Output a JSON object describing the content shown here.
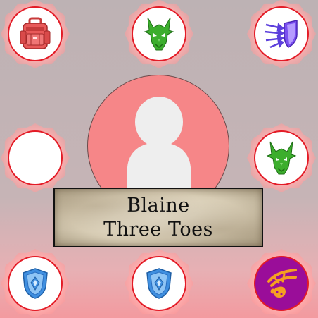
{
  "character": {
    "name_line1": "Blaine",
    "name_line2": "Three Toes"
  },
  "slots": [
    {
      "id": "top-left",
      "icon": "backpack-icon",
      "filled": true,
      "color": "#d94a4a"
    },
    {
      "id": "top-center",
      "icon": "dragon-head-icon",
      "filled": true,
      "color": "#3cae2d"
    },
    {
      "id": "top-right",
      "icon": "magic-shield-icon",
      "filled": true,
      "color": "#5c3fdc"
    },
    {
      "id": "middle-left",
      "icon": "",
      "filled": false
    },
    {
      "id": "middle-right",
      "icon": "dragon-head-icon",
      "filled": true,
      "color": "#3cae2d"
    },
    {
      "id": "bottom-left",
      "icon": "crystal-shield-icon",
      "filled": true,
      "color": "#3f8fe0"
    },
    {
      "id": "bottom-center",
      "icon": "crystal-shield-icon",
      "filled": true,
      "color": "#3f8fe0"
    },
    {
      "id": "bottom-right",
      "icon": "acid-claw-icon",
      "filled": true,
      "color": "#f5a021",
      "background": "#9a0d99"
    }
  ],
  "colors": {
    "slot_border": "#e31b26",
    "portrait_background": "#f68688",
    "silhouette": "#eeeeee"
  }
}
